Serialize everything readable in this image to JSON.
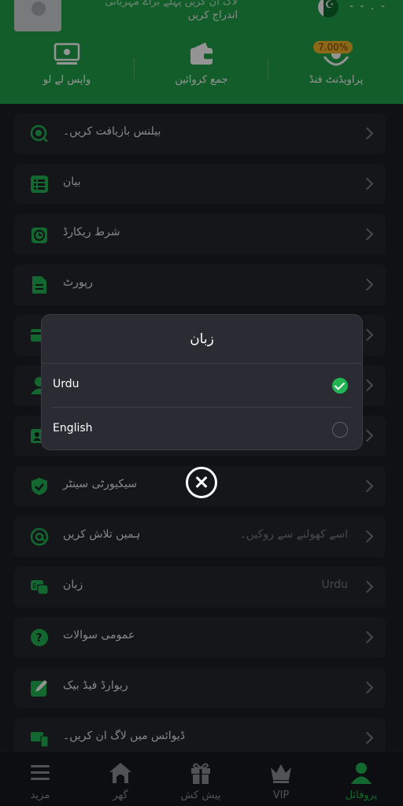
{
  "header": {
    "line1": "لاگ ان کریں پہلے براۓ مہربانی",
    "line2": "اندراج کریں",
    "dashes": "- - . -"
  },
  "quick_actions": [
    {
      "label": "واپس لے لو",
      "icon": "withdraw-icon"
    },
    {
      "label": "جمع کروائیں",
      "icon": "wallet-icon"
    },
    {
      "label": "پراویڈنٹ فنڈ",
      "icon": "fund-hand-icon",
      "badge": "7.00%"
    }
  ],
  "menu": [
    {
      "label": "بیلنس بازیافت کریں۔",
      "icon": "recycle-icon",
      "value": ""
    },
    {
      "label": "بیان",
      "icon": "list-icon",
      "value": ""
    },
    {
      "label": "شرط ریکارڈ",
      "icon": "clock-icon",
      "value": ""
    },
    {
      "label": "رپورٹ",
      "icon": "report-icon",
      "value": ""
    },
    {
      "label": "",
      "icon": "card-icon",
      "value": ""
    },
    {
      "label": "",
      "icon": "user-icon",
      "value": ""
    },
    {
      "label": "",
      "icon": "id-card-icon",
      "value": ""
    },
    {
      "label": "سیکیورٹی سینٹر",
      "icon": "shield-icon",
      "value": ""
    },
    {
      "label": "ہمیں تلاش کریں",
      "icon": "at-icon",
      "value": "اسے کھولنے سے روکیں۔"
    },
    {
      "label": "زبان",
      "icon": "language-icon",
      "value": "Urdu"
    },
    {
      "label": "عمومی سوالات",
      "icon": "question-icon",
      "value": ""
    },
    {
      "label": "ریوارڈ فیڈ بیک",
      "icon": "feedback-icon",
      "value": ""
    },
    {
      "label": "ڈیوائس میں لاگ ان کریں۔",
      "icon": "device-icon",
      "value": ""
    }
  ],
  "modal": {
    "title": "زبان",
    "options": [
      {
        "label": "Urdu",
        "selected": true
      },
      {
        "label": "English",
        "selected": false
      }
    ]
  },
  "nav": [
    {
      "label": "مزید",
      "icon": "menu-icon",
      "active": false
    },
    {
      "label": "گھر",
      "icon": "home-icon",
      "active": false
    },
    {
      "label": "پیش کش",
      "icon": "gift-icon",
      "active": false
    },
    {
      "label": "VIP",
      "icon": "crown-icon",
      "active": false
    },
    {
      "label": "پروفائل",
      "icon": "profile-icon",
      "active": true
    }
  ],
  "colors": {
    "accent": "#22b352",
    "header_bg": "#21a04a",
    "page_bg": "#1d1e24"
  }
}
